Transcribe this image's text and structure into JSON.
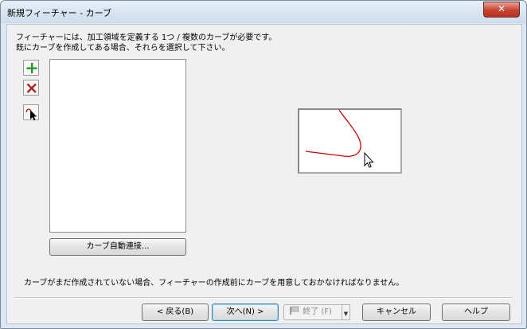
{
  "window": {
    "title": "新規フィーチャー - カーブ",
    "close_label": "✕"
  },
  "instructions": {
    "line1": "フィーチャーには、加工領域を定義する 1つ / 複数のカーブが必要です。",
    "line2": "既にカーブを作成してある場合、それらを選択して下さい。"
  },
  "toolbar": {
    "add_icon": "plus-icon",
    "delete_icon": "delete-x-icon",
    "select_icon": "select-curve-cursor-icon"
  },
  "curve_list": {
    "items": []
  },
  "auto_connect_button": {
    "label": "カーブ自動連接..."
  },
  "footer_note": "カーブがまだ作成されていない場合、フィーチャーの作成前にカーブを用意しておかなければなりません。",
  "buttons": {
    "back": "< 戻る(B)",
    "next": "次へ(N) >",
    "finish": "終了 (F)",
    "cancel": "キャンセル",
    "help": "ヘルプ"
  },
  "colors": {
    "preview_curve": "#cc0000",
    "add_icon": "#1e9b1e",
    "delete_icon": "#b22222"
  }
}
